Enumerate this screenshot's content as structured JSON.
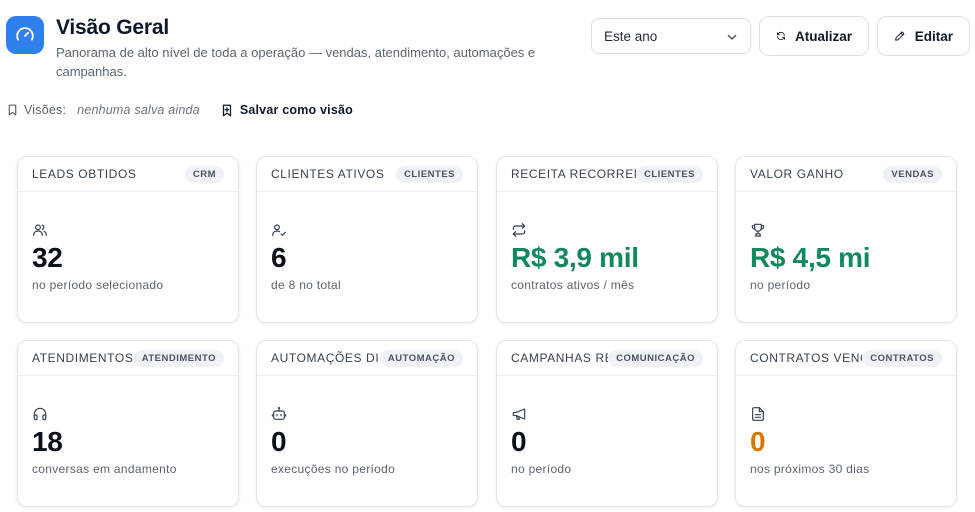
{
  "header": {
    "title": "Visão Geral",
    "subtitle": "Panorama de alto nível de toda a operação — vendas, atendimento, automações e campanhas.",
    "logo_icon": "gauge-icon",
    "accent_color": "#2f80ed"
  },
  "period_select": {
    "value": "Este ano"
  },
  "toolbar": {
    "refresh_label": "Atualizar",
    "edit_label": "Editar"
  },
  "views": {
    "label": "Visões:",
    "empty_text": "nenhuma salva ainda",
    "save_label": "Salvar como visão"
  },
  "cards": [
    {
      "title": "LEADS OBTIDOS",
      "badge": "CRM",
      "icon": "users-icon",
      "value": "32",
      "sub": "no período selecionado"
    },
    {
      "title": "CLIENTES ATIVOS",
      "badge": "CLIENTES",
      "icon": "user-check-icon",
      "value": "6",
      "sub": "de 8 no total"
    },
    {
      "title": "RECEITA RECORRENTE",
      "badge": "CLIENTES",
      "icon": "repeat-icon",
      "value": "R$ 3,9 mil",
      "sub": "contratos ativos / mês",
      "value_color": "#11895a"
    },
    {
      "title": "VALOR GANHO",
      "badge": "VENDAS",
      "icon": "trophy-icon",
      "value": "R$ 4,5 mi",
      "sub": "no período",
      "value_color": "#11895a"
    },
    {
      "title": "ATENDIMENTOS ATIVOS",
      "badge": "ATENDIMENTO",
      "icon": "headset-icon",
      "value": "18",
      "sub": "conversas em andamento"
    },
    {
      "title": "AUTOMAÇÕES DISPARADAS",
      "badge": "AUTOMAÇÃO",
      "icon": "bot-icon",
      "value": "0",
      "sub": "execuções no período"
    },
    {
      "title": "CAMPANHAS REALIZADAS",
      "badge": "COMUNICAÇÃO",
      "icon": "megaphone-icon",
      "value": "0",
      "sub": "no período"
    },
    {
      "title": "CONTRATOS VENCENDO",
      "badge": "CONTRATOS",
      "icon": "document-icon",
      "value": "0",
      "sub": "nos próximos 30 dias",
      "value_color": "#d97706"
    }
  ]
}
